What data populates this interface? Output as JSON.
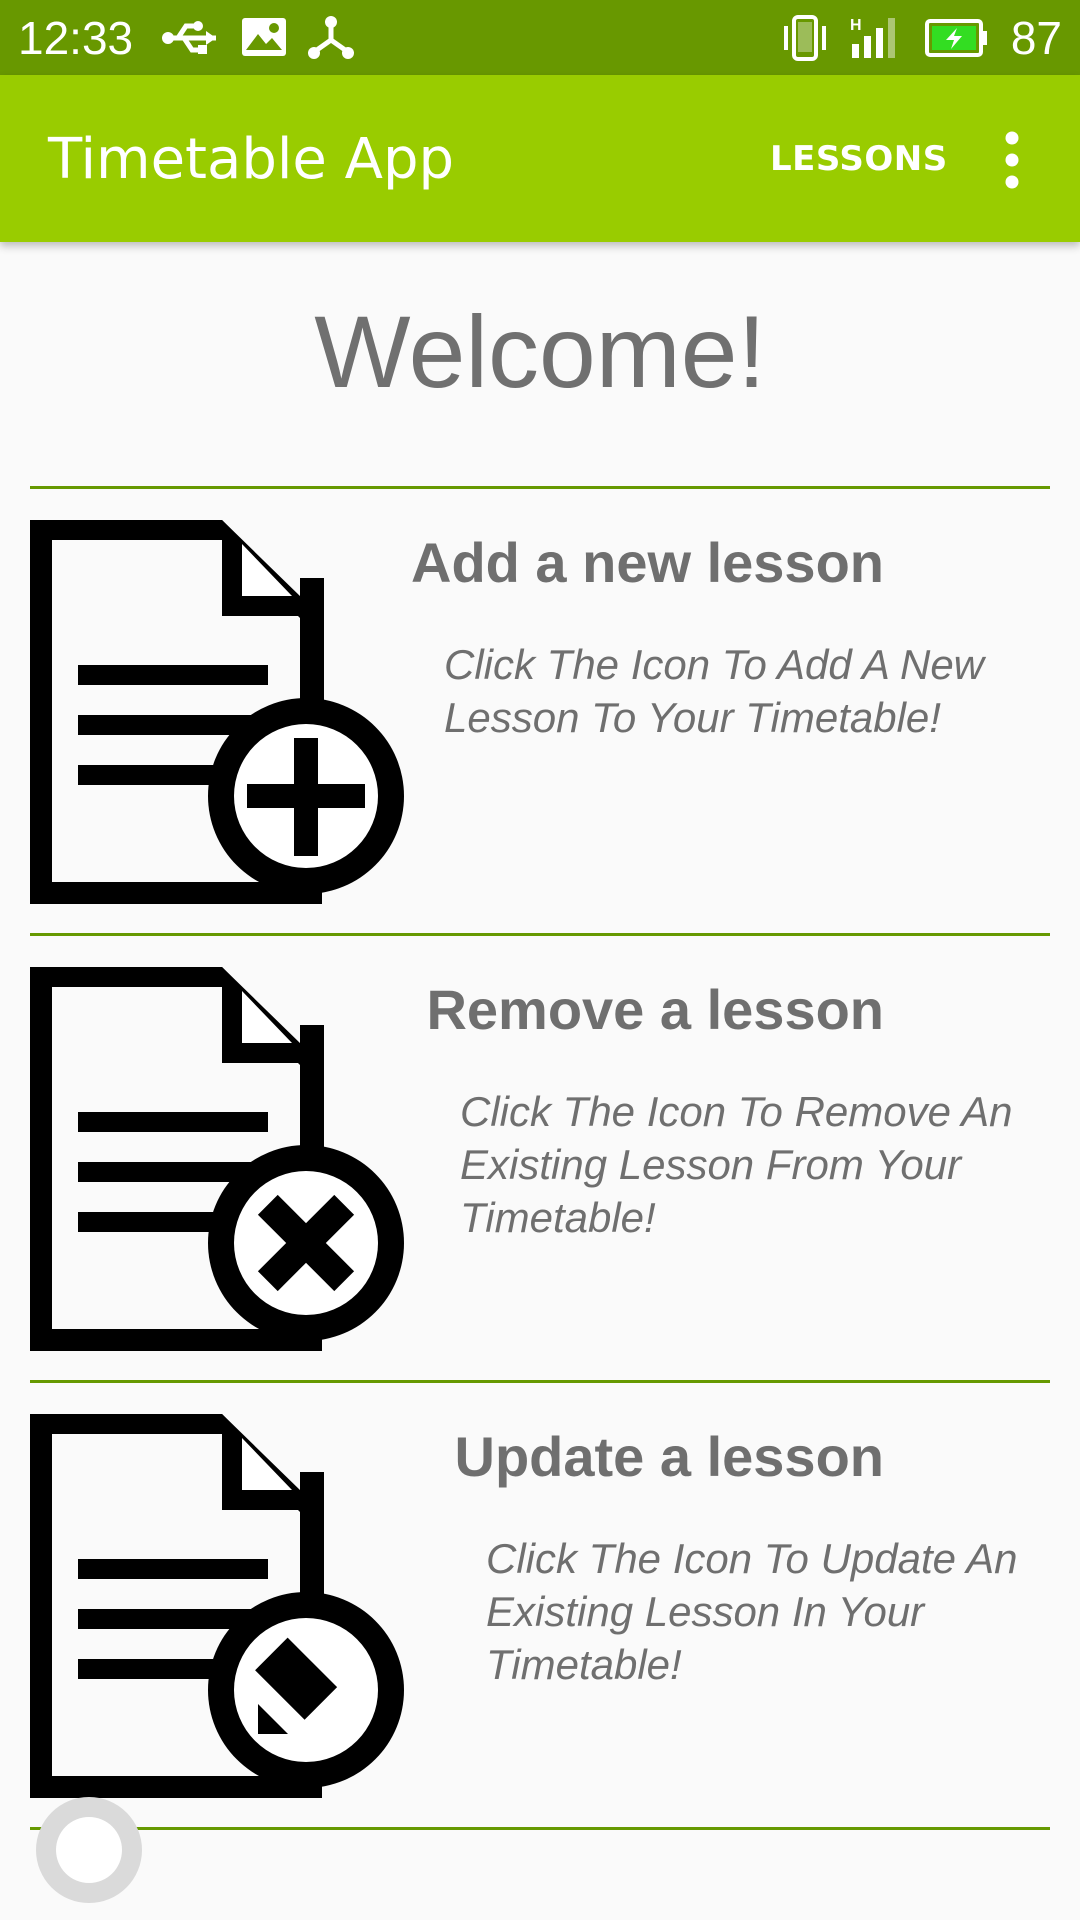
{
  "status_bar": {
    "time": "12:33",
    "battery": "87",
    "icons": [
      "usb-icon",
      "image-icon",
      "share-icon",
      "vibrate-icon",
      "signal-icon",
      "battery-charging-icon"
    ],
    "color": "#689800"
  },
  "app_bar": {
    "title": "Timetable App",
    "lessons_label": "LESSONS",
    "menu_icon": "more-vert-icon",
    "color": "#99cc00"
  },
  "main": {
    "welcome": "Welcome!",
    "rows": [
      {
        "title": "Add a new lesson",
        "description": "Click The Icon To Add A New Lesson To Your Timetable!",
        "icon": "add-document-icon"
      },
      {
        "title": "Remove a lesson",
        "description": "Click The Icon To Remove An Existing Lesson From Your Timetable!",
        "icon": "remove-document-icon"
      },
      {
        "title": "Update a lesson",
        "description": "Click The Icon To Update An Existing Lesson In Your Timetable!",
        "icon": "edit-document-icon"
      }
    ],
    "divider_color": "#669900",
    "text_color": "#6f6f6f"
  }
}
